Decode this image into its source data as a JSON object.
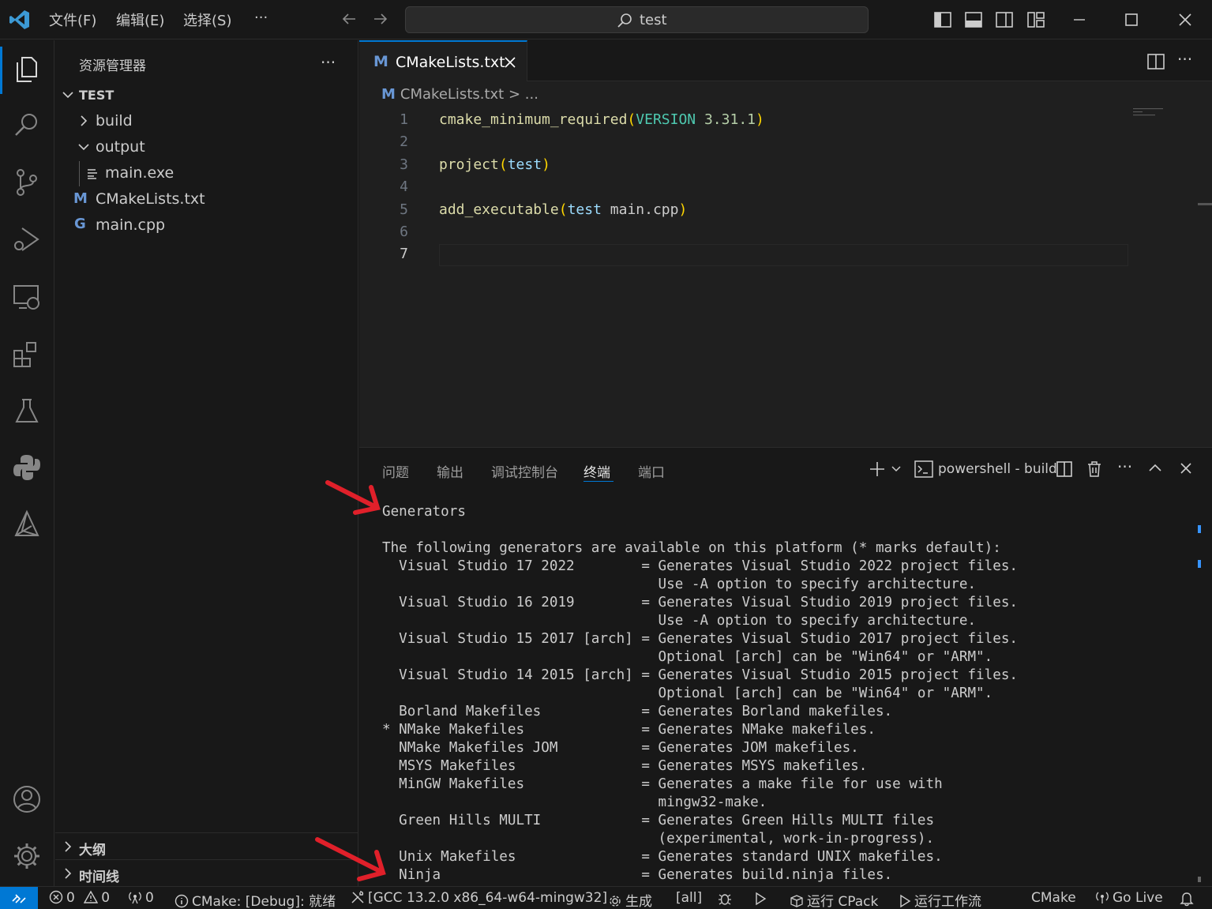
{
  "titlebar": {
    "menus": [
      "文件(F)",
      "编辑(E)",
      "选择(S)",
      "···"
    ],
    "search_text": "test"
  },
  "sidebar": {
    "title": "资源管理器",
    "root": "TEST",
    "items": [
      {
        "label": "build",
        "type": "folder-collapsed"
      },
      {
        "label": "output",
        "type": "folder-expanded"
      },
      {
        "label": "main.exe",
        "type": "file"
      },
      {
        "label": "CMakeLists.txt",
        "type": "cmake"
      },
      {
        "label": "main.cpp",
        "type": "cpp"
      }
    ],
    "sections": [
      "大纲",
      "时间线"
    ]
  },
  "editor": {
    "tab_label": "CMakeLists.txt",
    "breadcrumb": "CMakeLists.txt > ...",
    "line_numbers": [
      "1",
      "2",
      "3",
      "4",
      "5",
      "6",
      "7"
    ],
    "code": {
      "l1_fn": "cmake_minimum_required",
      "l1_kw": "VERSION",
      "l1_num": "3.31.1",
      "l3_fn": "project",
      "l3_arg": "test",
      "l5_fn": "add_executable",
      "l5_arg1": "test",
      "l5_arg2": "main.cpp"
    }
  },
  "panel": {
    "tabs": [
      "问题",
      "输出",
      "调试控制台",
      "终端",
      "端口"
    ],
    "active_tab": "终端",
    "terminal_name": "powershell - build",
    "terminal_output": "Generators\n\nThe following generators are available on this platform (* marks default):\n  Visual Studio 17 2022        = Generates Visual Studio 2022 project files.\n                                 Use -A option to specify architecture.\n  Visual Studio 16 2019        = Generates Visual Studio 2019 project files.\n                                 Use -A option to specify architecture.\n  Visual Studio 15 2017 [arch] = Generates Visual Studio 2017 project files.\n                                 Optional [arch] can be \"Win64\" or \"ARM\".\n  Visual Studio 14 2015 [arch] = Generates Visual Studio 2015 project files.\n                                 Optional [arch] can be \"Win64\" or \"ARM\".\n  Borland Makefiles            = Generates Borland makefiles.\n* NMake Makefiles              = Generates NMake makefiles.\n  NMake Makefiles JOM          = Generates JOM makefiles.\n  MSYS Makefiles               = Generates MSYS makefiles.\n  MinGW Makefiles              = Generates a make file for use with\n                                 mingw32-make.\n  Green Hills MULTI            = Generates Green Hills MULTI files\n                                 (experimental, work-in-progress).\n  Unix Makefiles               = Generates standard UNIX makefiles.\n  Ninja                        = Generates build.ninja files."
  },
  "statusbar": {
    "errors": "0",
    "warnings": "0",
    "ports": "0",
    "cmake_status": "CMake: [Debug]: 就绪",
    "kit": "[GCC 13.2.0 x86_64-w64-mingw32]",
    "build": "生成",
    "target": "[all]",
    "cpack": "运行 CPack",
    "workflow": "运行工作流",
    "cmake": "CMake",
    "golive": "Go Live"
  },
  "colors": {
    "accent": "#0078d4",
    "annotation_arrow": "#e0202a"
  }
}
